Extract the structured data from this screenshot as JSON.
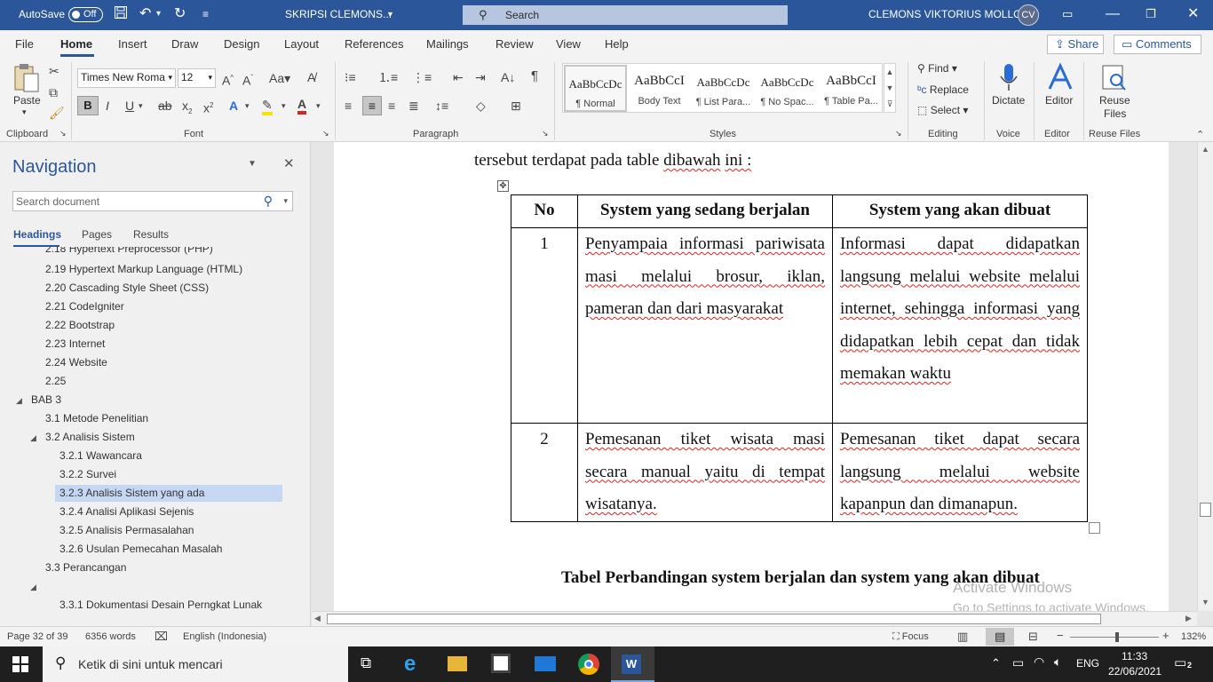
{
  "titlebar": {
    "autosave_label": "AutoSave",
    "autosave_state": "Off",
    "doc_title": "SKRIPSI CLEMONS...",
    "search_placeholder": "Search",
    "user_name": "CLEMONS VIKTORIUS MOLLO",
    "user_initials": "CV",
    "accent_color": "#2b579a"
  },
  "tabs": [
    "File",
    "Home",
    "Insert",
    "Draw",
    "Design",
    "Layout",
    "References",
    "Mailings",
    "Review",
    "View",
    "Help"
  ],
  "share_label": "Share",
  "comments_label": "Comments",
  "ribbon": {
    "clipboard": {
      "paste_label": "Paste",
      "group_label": "Clipboard"
    },
    "font": {
      "family": "Times New Roma",
      "size": "12",
      "group_label": "Font"
    },
    "paragraph": {
      "group_label": "Paragraph"
    },
    "styles": {
      "group_label": "Styles",
      "items": [
        {
          "preview": "AaBbCcDc",
          "name": "¶ Normal"
        },
        {
          "preview": "AaBbCcI",
          "name": "Body Text"
        },
        {
          "preview": "AaBbCcDc",
          "name": "¶ List Para..."
        },
        {
          "preview": "AaBbCcDc",
          "name": "¶ No Spac..."
        },
        {
          "preview": "AaBbCcI",
          "name": "¶ Table Pa..."
        }
      ]
    },
    "editing": {
      "find": "Find",
      "replace": "Replace",
      "select": "Select",
      "group_label": "Editing"
    },
    "voice": {
      "dictate": "Dictate",
      "group_label": "Voice"
    },
    "editor": {
      "label": "Editor",
      "group_label": "Editor"
    },
    "reuse": {
      "label1": "Reuse",
      "label2": "Files",
      "group_label": "Reuse Files"
    }
  },
  "nav": {
    "title": "Navigation",
    "search_placeholder": "Search document",
    "tabs": [
      "Headings",
      "Pages",
      "Results"
    ],
    "headings": [
      "2.18 Hypertext Preprocessor (PHP)",
      "2.19 Hypertext Markup Language (HTML)",
      "2.20 Cascading Style Sheet (CSS)",
      "2.21 CodeIgniter",
      "2.22 Bootstrap",
      "2.23 Internet",
      "2.24 Website",
      "2.25",
      "BAB 3",
      "3.1 Metode Penelitian",
      "3.2 Analisis Sistem",
      "3.2.1 Wawancara",
      "3.2.2 Survei",
      "3.2.3 Analisis Sistem yang ada",
      "3.2.4 Analisi Aplikasi Sejenis",
      "3.2.5 Analisis Permasalahan",
      "3.2.6 Usulan Pemecahan Masalah",
      "3.3 Perancangan",
      "",
      "3.3.1 Dokumentasi Desain Perngkat Lunak"
    ]
  },
  "doc": {
    "intro_words": [
      "tersebut",
      "terdapat",
      "pada",
      "table",
      "dibawah",
      "ini :"
    ],
    "table": {
      "headers": [
        "No",
        "System yang sedang berjalan",
        "System yang akan dibuat"
      ],
      "rows": [
        {
          "no": "1",
          "current": "Penyampaia informasi pariwisata masi melalui brosur, iklan, pameran dan dari masyarakat",
          "planned": "Informasi dapat didapatkan langsung melalui website melalui internet, sehingga informasi yang didapatkan lebih cepat dan tidak memakan waktu"
        },
        {
          "no": "2",
          "current": "Pemesanan tiket wisata masi secara manual yaitu di tempat wisatanya.",
          "planned": "Pemesanan tiket dapat secara langsung melalui website kapanpun dan dimanapun."
        }
      ]
    },
    "caption": "Tabel Perbandingan system berjalan dan system yang akan dibuat"
  },
  "watermark": {
    "line1": "Activate Windows",
    "line2": "Go to Settings to activate Windows."
  },
  "status": {
    "page": "Page 32 of 39",
    "words": "6356 words",
    "language": "English (Indonesia)",
    "focus": "Focus",
    "zoom": "132%"
  },
  "taskbar": {
    "search_placeholder": "Ketik di sini untuk mencari",
    "lang": "ENG",
    "time": "11:33",
    "date": "22/06/2021",
    "notifications": "2"
  }
}
